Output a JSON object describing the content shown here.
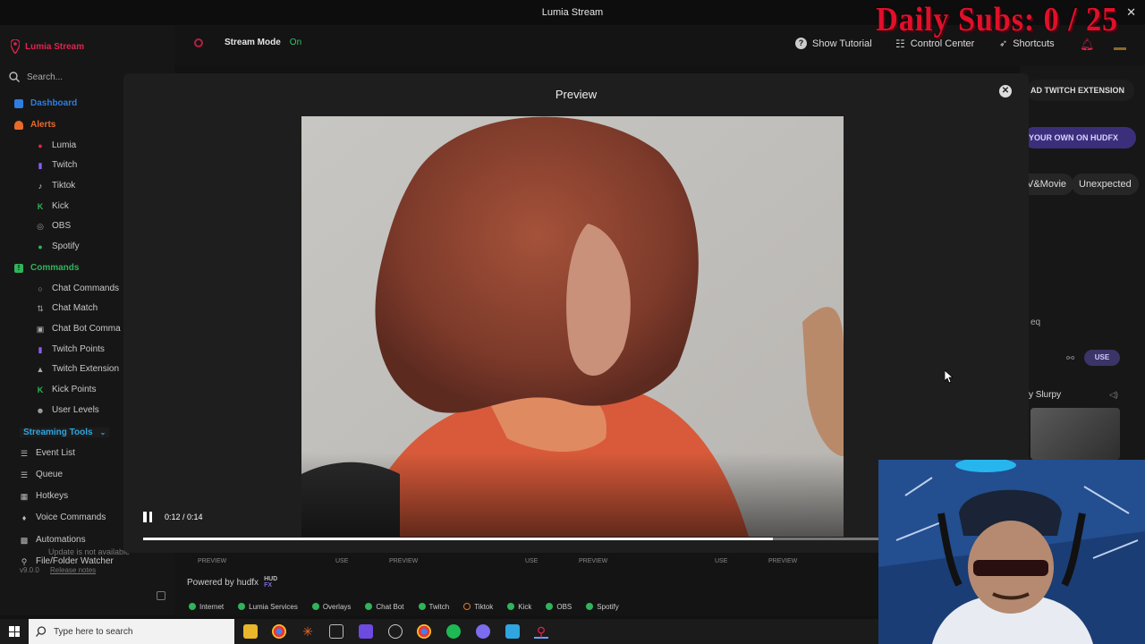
{
  "window": {
    "title": "Lumia Stream",
    "close": "✕"
  },
  "overlay": {
    "daily_subs": "Daily Subs: 0 / 25"
  },
  "brand": {
    "name": "Lumia Stream"
  },
  "search": {
    "placeholder": "Search..."
  },
  "sidebar": {
    "dashboard": "Dashboard",
    "alerts": "Alerts",
    "alerts_items": [
      "Lumia",
      "Twitch",
      "Tiktok",
      "Kick",
      "OBS",
      "Spotify"
    ],
    "commands": "Commands",
    "commands_items": [
      "Chat Commands",
      "Chat Match",
      "Chat Bot Comma",
      "Twitch Points",
      "Twitch Extension",
      "Kick Points",
      "User Levels"
    ],
    "streaming_tools": "Streaming Tools",
    "tools_items": [
      "Event List",
      "Queue",
      "Hotkeys",
      "Voice Commands",
      "Automations",
      "File/Folder Watcher"
    ],
    "update_status": "Update is not available",
    "version": "v9.0.0",
    "release_notes": "Release notes"
  },
  "topbar": {
    "stream_mode_label": "Stream Mode",
    "stream_mode_value": "On",
    "show_tutorial": "Show Tutorial",
    "control_center": "Control Center",
    "shortcuts": "Shortcuts"
  },
  "background": {
    "twitch_extension": "AD TWITCH EXTENSION",
    "hudfx": "YOUR OWN ON HUDFX",
    "categories": [
      "V&Movie",
      "Unexpected"
    ],
    "fragment": "eq",
    "use": "USE",
    "slurpy": "y Slurpy"
  },
  "modal": {
    "title": "Preview",
    "time": "0:12 / 0:14",
    "progress": 0.857
  },
  "below": {
    "powered_by": "Powered by hudfx",
    "hud_logo_top": "HUD",
    "hud_logo_bottom": "FX",
    "preview_label": "PREVIEW",
    "use_label": "USE"
  },
  "status": [
    {
      "label": "Internet",
      "state": "ok"
    },
    {
      "label": "Lumia Services",
      "state": "ok"
    },
    {
      "label": "Overlays",
      "state": "ok"
    },
    {
      "label": "Chat Bot",
      "state": "ok"
    },
    {
      "label": "Twitch",
      "state": "ok"
    },
    {
      "label": "Tiktok",
      "state": "warn"
    },
    {
      "label": "Kick",
      "state": "ok"
    },
    {
      "label": "OBS",
      "state": "ok"
    },
    {
      "label": "Spotify",
      "state": "ok"
    }
  ],
  "taskbar": {
    "search_placeholder": "Type here to search"
  },
  "colors": {
    "accent": "#e0234e",
    "brand_blue": "#2e7de0",
    "alerts_orange": "#e86a2a",
    "commands_green": "#2fb45a",
    "tools_blue": "#2fa6e0",
    "ok": "#2fb45a"
  }
}
